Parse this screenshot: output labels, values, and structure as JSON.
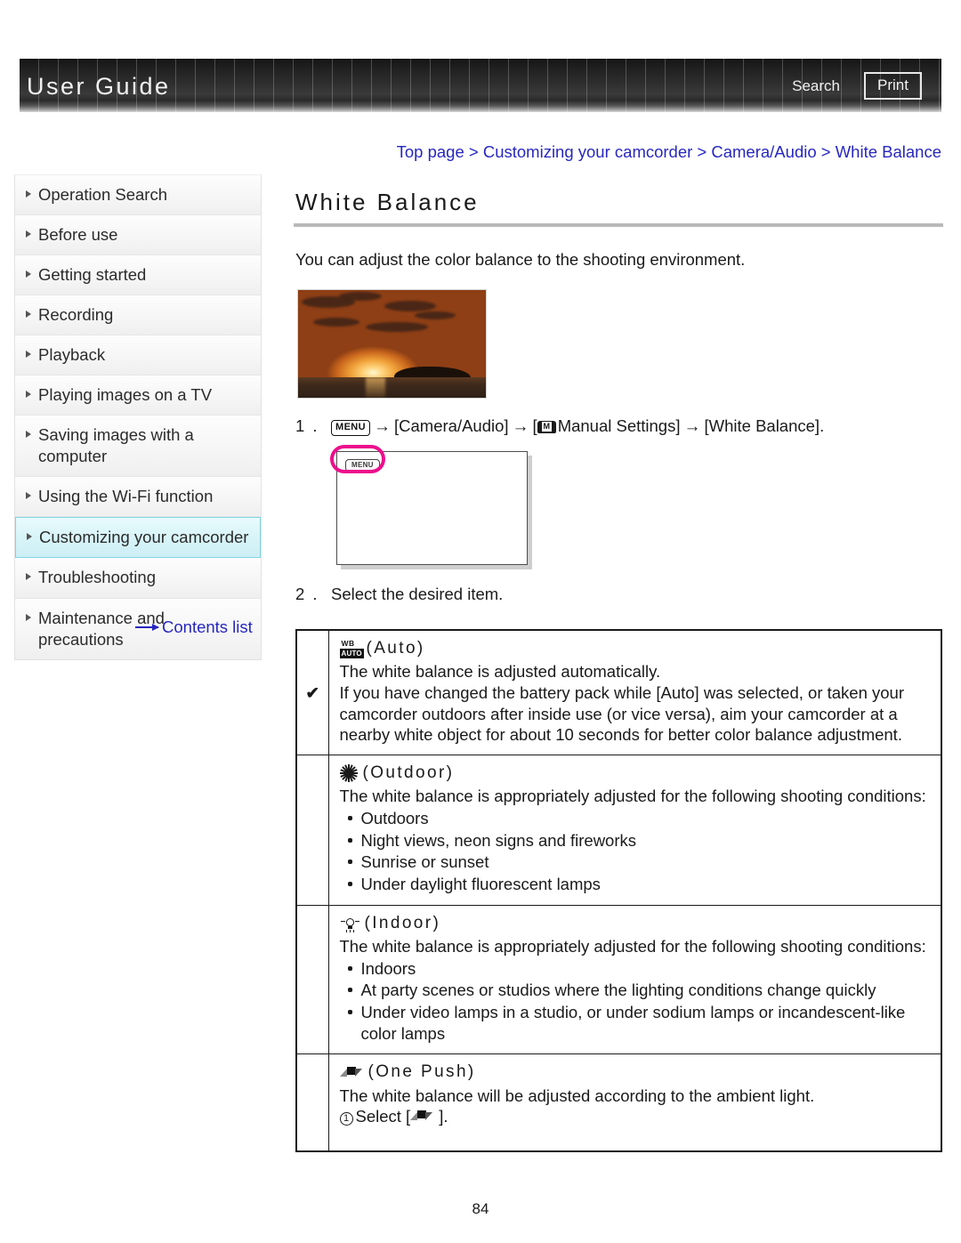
{
  "header": {
    "brand": "User Guide",
    "search_label": "Search",
    "print_label": "Print"
  },
  "sidebar": {
    "items": [
      {
        "label": "Operation Search",
        "active": false
      },
      {
        "label": "Before use",
        "active": false
      },
      {
        "label": "Getting started",
        "active": false
      },
      {
        "label": "Recording",
        "active": false
      },
      {
        "label": "Playback",
        "active": false
      },
      {
        "label": "Playing images on a TV",
        "active": false
      },
      {
        "label": "Saving images with a computer",
        "active": false
      },
      {
        "label": "Using the Wi-Fi function",
        "active": false
      },
      {
        "label": "Customizing your camcorder",
        "active": true
      },
      {
        "label": "Troubleshooting",
        "active": false
      },
      {
        "label": "Maintenance and precautions",
        "active": false
      }
    ],
    "contents_list_label": "Contents list",
    "highlight_color": "#cdeff5",
    "link_color": "#2727c0"
  },
  "main": {
    "breadcrumb": "Top page > Customizing your camcorder > Camera/Audio > White Balance",
    "title": "White Balance",
    "intro": "You can adjust the color balance to the shooting environment.",
    "steps": [
      {
        "number": "1 .",
        "text_before_menu": "",
        "menu_icon_label": "MENU",
        "part1": "[Camera/Audio]",
        "part2_prefix": "[",
        "part2": "Manual Settings]",
        "part3": "[White Balance].",
        "arrow": "→"
      },
      {
        "number": "2 .",
        "text": "Select the desired item."
      }
    ],
    "screen_mock": {
      "menu_button_label": "MENU",
      "highlight_color": "#ec0f8c"
    },
    "options": [
      {
        "checked": true,
        "check_mark": "✔",
        "icon": "wb-auto-icon",
        "title": "(Auto)",
        "paragraphs": [
          "The white balance is adjusted automatically.",
          "If you have changed the battery pack while [Auto] was selected, or taken your camcorder outdoors after inside use (or vice versa), aim your camcorder at a nearby white object for about 10 seconds for better color balance adjustment."
        ],
        "bullets": []
      },
      {
        "checked": false,
        "check_mark": "",
        "icon": "sun-icon",
        "title": "(Outdoor)",
        "paragraphs": [
          "The white balance is appropriately adjusted for the following shooting conditions:"
        ],
        "bullets": [
          "Outdoors",
          "Night views, neon signs and fireworks",
          "Sunrise or sunset",
          "Under daylight fluorescent lamps"
        ]
      },
      {
        "checked": false,
        "check_mark": "",
        "icon": "bulb-icon",
        "title": "(Indoor)",
        "paragraphs": [
          "The white balance is appropriately adjusted for the following shooting conditions:"
        ],
        "bullets": [
          "Indoors",
          "At party scenes or studios where the lighting conditions change quickly",
          "Under video lamps in a studio, or under sodium lamps or incandescent-like color lamps"
        ]
      },
      {
        "checked": false,
        "check_mark": "",
        "icon": "one-push-icon",
        "title": "(One Push)",
        "paragraphs": [
          "The white balance will be adjusted according to the ambient light."
        ],
        "substep_number": "1",
        "substep_prefix": "Select [",
        "substep_suffix": "].",
        "bullets": []
      }
    ]
  },
  "footer": {
    "page_number": "84"
  }
}
